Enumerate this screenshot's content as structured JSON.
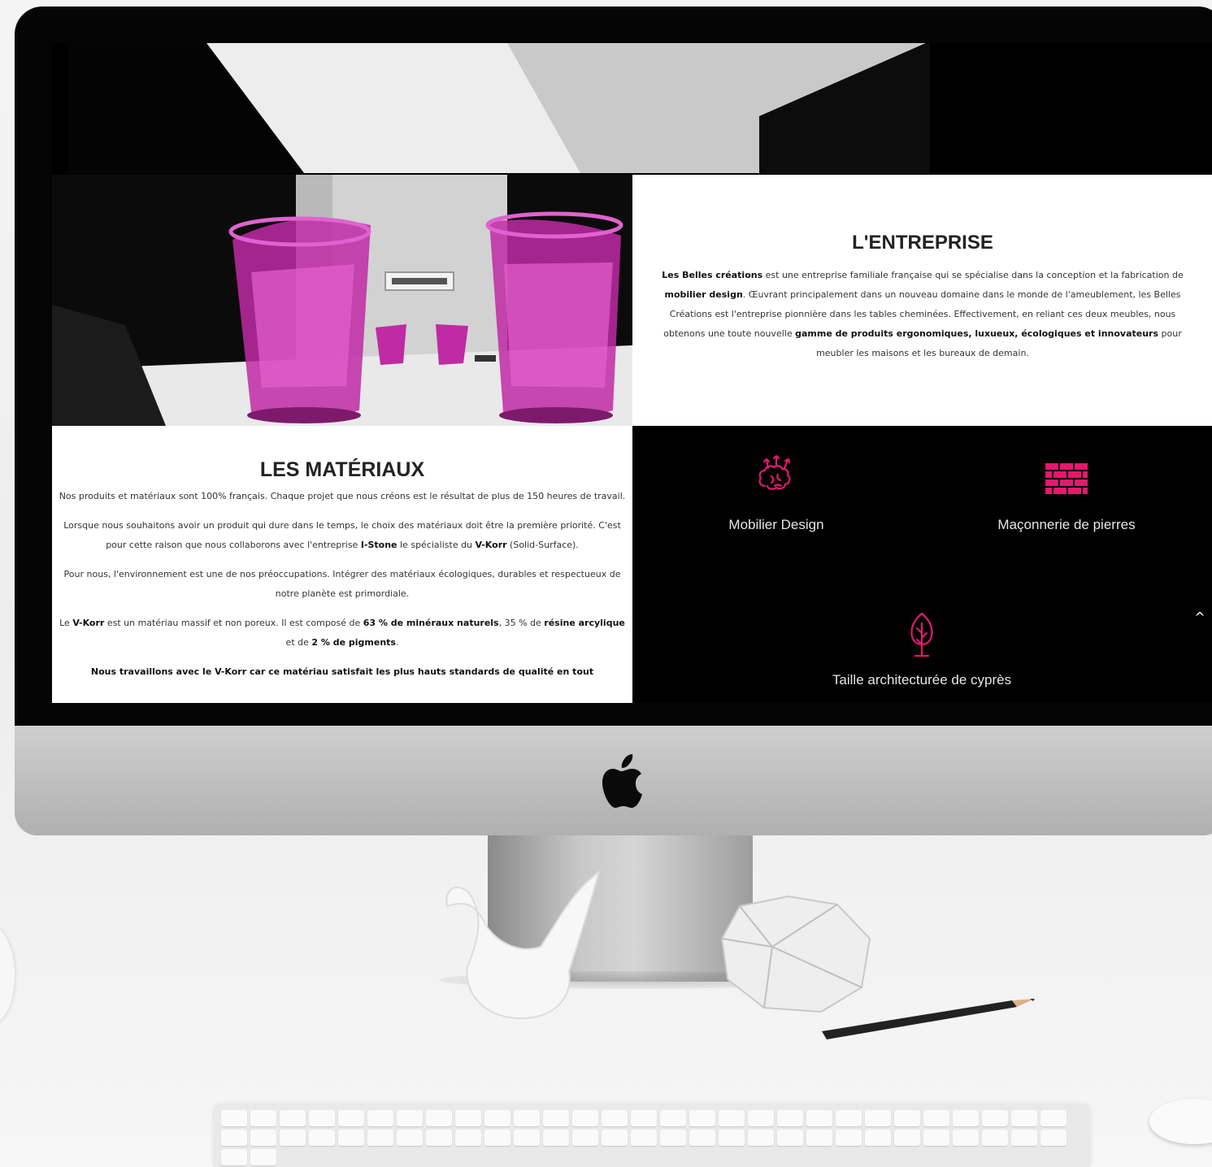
{
  "colors": {
    "accent": "#e01a6f",
    "dark": "#000000",
    "light": "#ffffff"
  },
  "intro": {
    "title": "L'ENTREPRISE",
    "parts": [
      {
        "t": "Les Belles créations",
        "b": true
      },
      {
        "t": " est une entreprise familiale française qui se spécialise dans la conception et la fabrication de ",
        "b": false
      },
      {
        "t": "mobilier design",
        "b": true
      },
      {
        "t": ". Œuvrant principalement dans un nouveau domaine dans le monde de l'ameublement, les Belles Créations est l'entreprise pionnière dans les tables cheminées. Effectivement, en reliant ces deux meubles, nous obtenons une toute nouvelle ",
        "b": false
      },
      {
        "t": "gamme de produits ergonomiques, luxueux, écologiques et innovateurs",
        "b": true
      },
      {
        "t": " pour meubler les maisons et les bureaux de demain.",
        "b": false
      }
    ]
  },
  "materials": {
    "title": "LES MATÉRIAUX",
    "paragraphs": [
      [
        {
          "t": "Nos produits et matériaux sont 100% français. Chaque projet que nous créons est le résultat de plus de 150 heures de travail.",
          "b": false
        }
      ],
      [
        {
          "t": "Lorsque nous souhaitons avoir un produit qui dure dans le temps, le choix des matériaux doit être la première priorité. C'est pour cette raison que nous collaborons avec l'entreprise ",
          "b": false
        },
        {
          "t": "I-Stone",
          "b": true
        },
        {
          "t": " le spécialiste du ",
          "b": false
        },
        {
          "t": "V-Korr",
          "b": true
        },
        {
          "t": " (Solid-Surface).",
          "b": false
        }
      ],
      [
        {
          "t": "Pour nous, l'environnement est une de nos préoccupations. Intégrer des matériaux écologiques, durables et respectueux de notre planète est primordiale.",
          "b": false
        }
      ],
      [
        {
          "t": "Le ",
          "b": false
        },
        {
          "t": "V-Korr",
          "b": true
        },
        {
          "t": " est un matériau massif et non poreux. Il est composé de ",
          "b": false
        },
        {
          "t": "63 % de minéraux naturels",
          "b": true
        },
        {
          "t": ", 35 % de ",
          "b": false
        },
        {
          "t": "résine arcylique",
          "b": true
        },
        {
          "t": " et de ",
          "b": false
        },
        {
          "t": "2 % de pigments",
          "b": true
        },
        {
          "t": ".",
          "b": false
        }
      ],
      [
        {
          "t": "Nous travaillons avec le V-Korr car ce matériau satisfait les plus hauts standards de qualité en tout",
          "b": true
        }
      ]
    ]
  },
  "services": [
    {
      "label": "Mobilier Design",
      "icon": "brain-icon"
    },
    {
      "label": "Maçonnerie de pierres",
      "icon": "brick-wall-icon"
    },
    {
      "label": "Taille architecturée de cyprès",
      "icon": "tree-icon"
    }
  ],
  "scroll_top": {
    "glyph": "^"
  }
}
